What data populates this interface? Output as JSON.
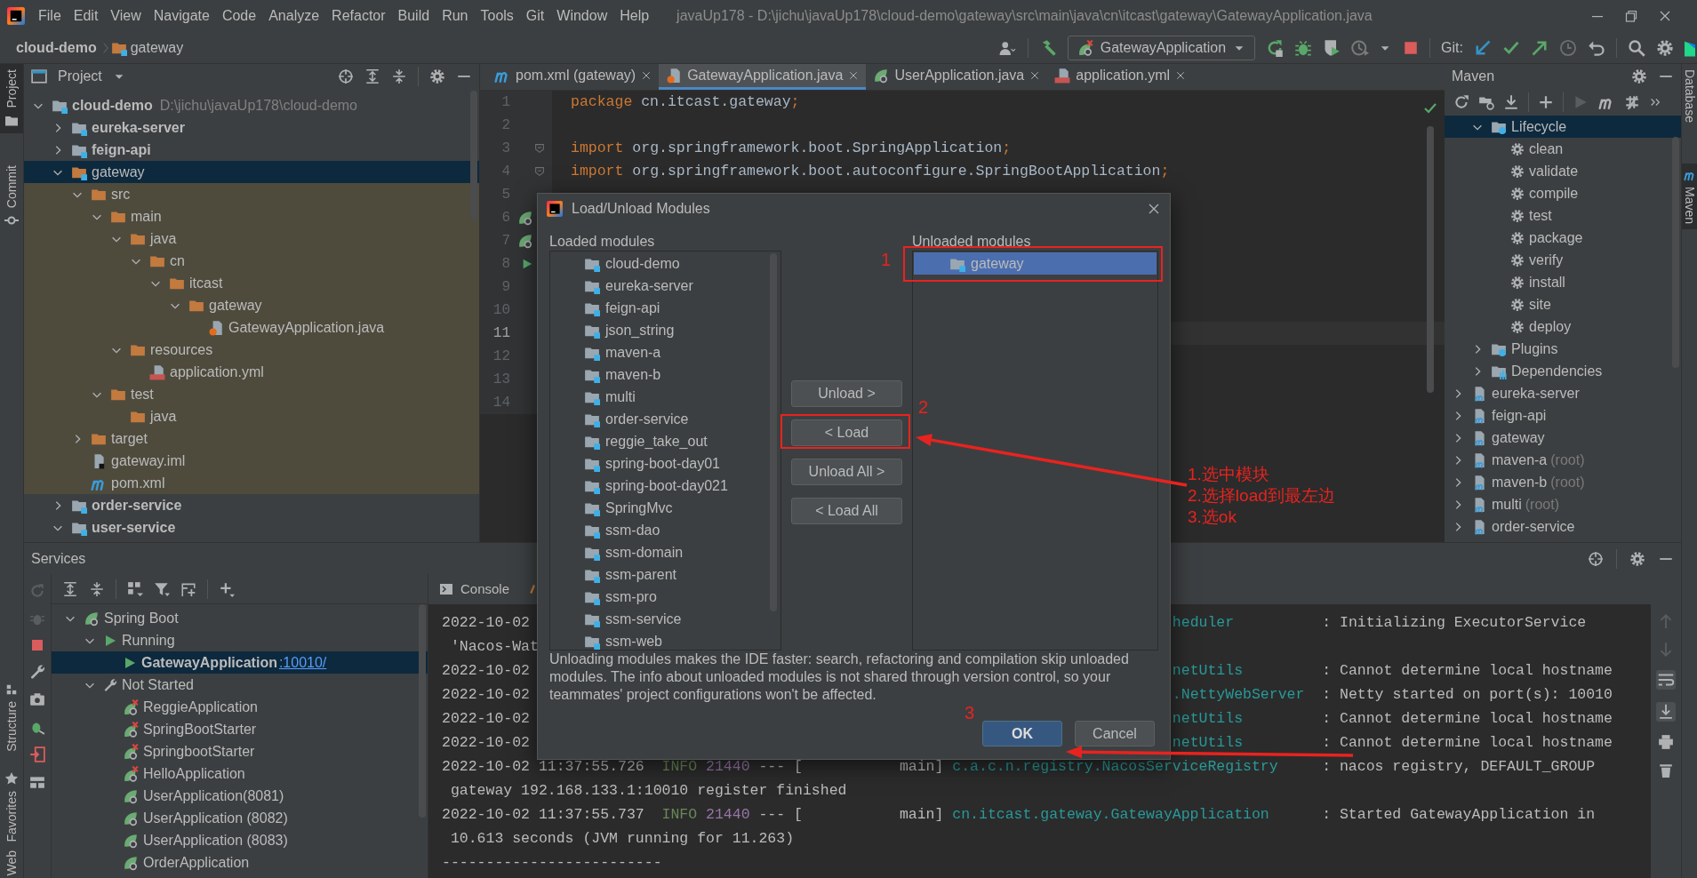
{
  "window": {
    "title": "javaUp178 - D:\\jichu\\javaUp178\\cloud-demo\\gateway\\src\\main\\java\\cn\\itcast\\gateway\\GatewayApplication.java",
    "menu": [
      "File",
      "Edit",
      "View",
      "Navigate",
      "Code",
      "Analyze",
      "Refactor",
      "Build",
      "Run",
      "Tools",
      "Git",
      "Window",
      "Help"
    ]
  },
  "breadcrumb": [
    {
      "label": "cloud-demo",
      "kind": "project"
    },
    {
      "label": "gateway",
      "kind": "module"
    }
  ],
  "toolbar": {
    "run_config": "GatewayApplication",
    "git_label": "Git:"
  },
  "left_stripe": [
    {
      "label": "Project",
      "selected": true
    },
    {
      "label": "Commit",
      "selected": false
    },
    {
      "label": "Structure",
      "selected": false
    },
    {
      "label": "Favorites",
      "selected": false
    },
    {
      "label": "Web",
      "selected": false
    }
  ],
  "right_stripe": [
    {
      "label": "Database",
      "selected": false
    },
    {
      "label": "Maven",
      "selected": true
    }
  ],
  "project_panel": {
    "title": "Project",
    "tree": [
      {
        "label": "cloud-demo",
        "hint": "D:\\jichu\\javaUp178\\cloud-demo",
        "kind": "module",
        "expanded": true,
        "selected": false,
        "children": [
          {
            "label": "eureka-server",
            "kind": "module",
            "expanded": false,
            "selected": false
          },
          {
            "label": "feign-api",
            "kind": "module",
            "expanded": false,
            "selected": false
          },
          {
            "label": "gateway",
            "kind": "module",
            "expanded": true,
            "selected": true,
            "unloaded": true,
            "children": [
              {
                "label": "src",
                "kind": "folder",
                "expanded": true,
                "selected": false,
                "children": [
                  {
                    "label": "main",
                    "kind": "folder",
                    "expanded": true,
                    "selected": false,
                    "children": [
                      {
                        "label": "java",
                        "kind": "folder",
                        "expanded": true,
                        "selected": false,
                        "children": [
                          {
                            "label": "cn",
                            "kind": "folder",
                            "expanded": true,
                            "selected": false,
                            "children": [
                              {
                                "label": "itcast",
                                "kind": "folder",
                                "expanded": true,
                                "selected": false,
                                "children": [
                                  {
                                    "label": "gateway",
                                    "kind": "folder",
                                    "expanded": true,
                                    "selected": false,
                                    "children": [
                                      {
                                        "label": "GatewayApplication.java",
                                        "kind": "java",
                                        "selected": false
                                      }
                                    ]
                                  }
                                ]
                              }
                            ]
                          }
                        ]
                      },
                      {
                        "label": "resources",
                        "kind": "folder",
                        "expanded": true,
                        "selected": false,
                        "children": [
                          {
                            "label": "application.yml",
                            "kind": "yml",
                            "selected": false
                          }
                        ]
                      }
                    ]
                  },
                  {
                    "label": "test",
                    "kind": "folder",
                    "expanded": true,
                    "selected": false,
                    "children": [
                      {
                        "label": "java",
                        "kind": "folder",
                        "selected": false
                      }
                    ]
                  }
                ]
              },
              {
                "label": "target",
                "kind": "folder",
                "expanded": false,
                "selected": false
              },
              {
                "label": "gateway.iml",
                "kind": "iml",
                "selected": false
              },
              {
                "label": "pom.xml",
                "kind": "pom",
                "selected": false
              }
            ]
          },
          {
            "label": "order-service",
            "kind": "module",
            "expanded": false,
            "selected": false
          },
          {
            "label": "user-service",
            "kind": "module",
            "expanded": true,
            "selected": false
          }
        ]
      }
    ]
  },
  "editor": {
    "tabs": [
      {
        "label": "pom.xml (gateway)",
        "kind": "pom",
        "selected": false
      },
      {
        "label": "GatewayApplication.java",
        "kind": "java",
        "selected": true
      },
      {
        "label": "UserApplication.java",
        "kind": "spring",
        "selected": false
      },
      {
        "label": "application.yml",
        "kind": "yml",
        "selected": false
      }
    ],
    "lines": [
      {
        "number": "1",
        "current": false,
        "code": [
          {
            "text": "package",
            "kind": "keyword"
          },
          {
            "text": " cn.itcast.gateway",
            "kind": "plain"
          },
          {
            "text": ";",
            "kind": "keyword"
          }
        ]
      },
      {
        "number": "2",
        "current": false
      },
      {
        "number": "3",
        "current": false,
        "gutter": {
          "kind": "fold"
        },
        "code": [
          {
            "text": "import",
            "kind": "keyword"
          },
          {
            "text": " org.springframework.boot.SpringApplication",
            "kind": "plain"
          },
          {
            "text": ";",
            "kind": "keyword"
          }
        ]
      },
      {
        "number": "4",
        "current": false,
        "gutter": {
          "kind": "fold"
        },
        "code": [
          {
            "text": "import",
            "kind": "keyword"
          },
          {
            "text": " org.springframework.boot.autoconfigure.SpringBootApplication",
            "kind": "plain"
          },
          {
            "text": ";",
            "kind": "keyword"
          }
        ]
      },
      {
        "number": "5",
        "current": false
      },
      {
        "number": "6",
        "current": false,
        "gutter": {
          "kind": "beans"
        }
      },
      {
        "number": "7",
        "current": false,
        "gutter": {
          "kind": "bean"
        }
      },
      {
        "number": "8",
        "current": false,
        "gutter": {
          "kind": "run"
        }
      },
      {
        "number": "9",
        "current": false
      },
      {
        "number": "10",
        "current": false
      },
      {
        "number": "11",
        "current": true
      },
      {
        "number": "12",
        "current": false
      },
      {
        "number": "13",
        "current": false
      },
      {
        "number": "14",
        "current": false
      }
    ]
  },
  "maven": {
    "title": "Maven",
    "continued_children": [
      {
        "label": "Lifecycle",
        "kind": "lifecycle",
        "expanded": true,
        "selected": true,
        "children": [
          {
            "label": "clean",
            "kind": "phase",
            "selected": false
          },
          {
            "label": "validate",
            "kind": "phase",
            "selected": false
          },
          {
            "label": "compile",
            "kind": "phase",
            "selected": false
          },
          {
            "label": "test",
            "kind": "phase",
            "selected": false
          },
          {
            "label": "package",
            "kind": "phase",
            "selected": false
          },
          {
            "label": "verify",
            "kind": "phase",
            "selected": false
          },
          {
            "label": "install",
            "kind": "phase",
            "selected": false
          },
          {
            "label": "site",
            "kind": "phase",
            "selected": false
          },
          {
            "label": "deploy",
            "kind": "phase",
            "selected": false
          }
        ]
      },
      {
        "label": "Plugins",
        "kind": "plugins",
        "expanded": false,
        "selected": false
      },
      {
        "label": "Dependencies",
        "kind": "dependencies",
        "expanded": false,
        "selected": false
      }
    ],
    "tree": [
      {
        "label": "eureka-server",
        "kind": "mvnmodule",
        "expanded": false,
        "selected": false
      },
      {
        "label": "feign-api",
        "kind": "mvnmodule",
        "expanded": false,
        "selected": false
      },
      {
        "label": "gateway",
        "kind": "mvnmodule",
        "expanded": false,
        "selected": false
      },
      {
        "label": "maven-a",
        "suffix": "(root)",
        "kind": "mvnmodule",
        "expanded": false,
        "selected": false
      },
      {
        "label": "maven-b",
        "suffix": "(root)",
        "kind": "mvnmodule",
        "expanded": false,
        "selected": false
      },
      {
        "label": "multi",
        "suffix": "(root)",
        "kind": "mvnmodule",
        "expanded": false,
        "selected": false
      },
      {
        "label": "order-service",
        "kind": "mvnmodule",
        "expanded": false,
        "selected": false
      }
    ]
  },
  "services": {
    "title": "Services",
    "tree": [
      {
        "label": "Spring Boot",
        "kind": "spring",
        "expanded": true,
        "selected": false,
        "children": [
          {
            "label": "Running",
            "kind": "running",
            "expanded": true,
            "selected": false,
            "children": [
              {
                "label": "GatewayApplication",
                "port": ":10010/",
                "kind": "app_running",
                "selected": true
              }
            ]
          },
          {
            "label": "Not Started",
            "kind": "not_started",
            "expanded": true,
            "selected": false,
            "children": [
              {
                "label": "ReggieApplication",
                "kind": "app",
                "error": true,
                "selected": false
              },
              {
                "label": "SpringBootStarter",
                "kind": "app",
                "error": true,
                "selected": false
              },
              {
                "label": "SpringbootStarter",
                "kind": "app",
                "error": true,
                "selected": false
              },
              {
                "label": "HelloApplication",
                "kind": "app",
                "error": true,
                "selected": false
              },
              {
                "label": "UserApplication(8081)",
                "kind": "app",
                "error": false,
                "selected": false
              },
              {
                "label": "UserApplication (8082)",
                "kind": "app",
                "error": false,
                "selected": false
              },
              {
                "label": "UserApplication (8083)",
                "kind": "app",
                "error": false,
                "selected": false
              },
              {
                "label": "OrderApplication",
                "kind": "app",
                "error": false,
                "selected": false
              }
            ]
          }
        ]
      }
    ],
    "console_tab": "Console",
    "console_lines": [
      {
        "left": [
          {
            "text": "2022-10-02",
            "kind": "timestamp"
          }
        ],
        "right": [
          {
            "text": "heduler",
            "kind": "logger"
          },
          {
            "text": ": Initializing ExecutorService",
            "kind": "message"
          }
        ]
      },
      {
        "left": [
          {
            "text": "'Nacos-Wat",
            "kind": "cont"
          }
        ]
      },
      {
        "left": [
          {
            "text": "2022-10-02",
            "kind": "timestamp"
          }
        ],
        "right": [
          {
            "text": "netUtils",
            "kind": "logger"
          },
          {
            "text": ": Cannot determine local hostname",
            "kind": "message"
          }
        ]
      },
      {
        "left": [
          {
            "text": "2022-10-02",
            "kind": "timestamp"
          }
        ],
        "right": [
          {
            "text": ".NettyWebServer",
            "kind": "logger"
          },
          {
            "text": ": Netty started on port(s): 10010",
            "kind": "message"
          }
        ]
      },
      {
        "left": [
          {
            "text": "2022-10-02",
            "kind": "timestamp"
          }
        ],
        "right": [
          {
            "text": "netUtils",
            "kind": "logger"
          },
          {
            "text": ": Cannot determine local hostname",
            "kind": "message"
          }
        ]
      },
      {
        "left": [
          {
            "text": "2022-10-02",
            "kind": "timestamp"
          }
        ],
        "right": [
          {
            "text": "netUtils",
            "kind": "logger"
          },
          {
            "text": ": Cannot determine local hostname",
            "kind": "message"
          }
        ]
      },
      {
        "left": [
          {
            "text": "2022-10-02 11:37:55.726",
            "kind": "timestamp"
          },
          {
            "text": "INFO",
            "kind": "level"
          },
          {
            "text": "21440",
            "kind": "pid"
          },
          {
            "text": "--- [           main]",
            "kind": "thread"
          },
          {
            "text": "c.a.c.n.registry.NacosServiceRegistry",
            "kind": "logger"
          },
          {
            "text": ": nacos registry, DEFAULT_GROUP",
            "kind": "message"
          }
        ]
      },
      {
        "left": [
          {
            "text": "gateway 192.168.133.1:10010 register finished",
            "kind": "cont"
          }
        ]
      },
      {
        "left": [
          {
            "text": "2022-10-02 11:37:55.737",
            "kind": "timestamp"
          },
          {
            "text": "INFO",
            "kind": "level"
          },
          {
            "text": "21440",
            "kind": "pid"
          },
          {
            "text": "--- [           main]",
            "kind": "thread"
          },
          {
            "text": "cn.itcast.gateway.GatewayApplication",
            "kind": "logger"
          },
          {
            "text": ": Started GatewayApplication in",
            "kind": "message"
          }
        ]
      },
      {
        "left": [
          {
            "text": "10.613 seconds (JVM running for 11.263)",
            "kind": "cont"
          }
        ]
      },
      {
        "left": [
          {
            "text": "-------------------------",
            "kind": "timestamp"
          }
        ]
      }
    ]
  },
  "dialog": {
    "title": "Load/Unload Modules",
    "loaded_label": "Loaded modules",
    "unloaded_label": "Unloaded modules",
    "loaded": [
      {
        "label": "cloud-demo",
        "selected": false
      },
      {
        "label": "eureka-server",
        "selected": false
      },
      {
        "label": "feign-api",
        "selected": false
      },
      {
        "label": "json_string",
        "selected": false
      },
      {
        "label": "maven-a",
        "selected": false
      },
      {
        "label": "maven-b",
        "selected": false
      },
      {
        "label": "multi",
        "selected": false
      },
      {
        "label": "order-service",
        "selected": false
      },
      {
        "label": "reggie_take_out",
        "selected": false
      },
      {
        "label": "spring-boot-day01",
        "selected": false
      },
      {
        "label": "spring-boot-day021",
        "selected": false
      },
      {
        "label": "SpringMvc",
        "selected": false
      },
      {
        "label": "ssm-dao",
        "selected": false
      },
      {
        "label": "ssm-domain",
        "selected": false
      },
      {
        "label": "ssm-parent",
        "selected": false
      },
      {
        "label": "ssm-pro",
        "selected": false
      },
      {
        "label": "ssm-service",
        "selected": false
      },
      {
        "label": "ssm-web",
        "selected": false
      }
    ],
    "unloaded": [
      {
        "label": "gateway",
        "selected": true
      }
    ],
    "move_buttons": [
      "Unload >",
      "< Load",
      "Unload All >",
      "< Load All"
    ],
    "description": "Unloading modules makes the IDE faster: search, refactoring and compilation skip unloaded modules. The info about unloaded modules is not shared through version control, so your teammates' project configurations won't be affected.",
    "footer_buttons": [
      {
        "label": "OK",
        "kind": "primary"
      },
      {
        "label": "Cancel",
        "kind": "secondary"
      }
    ]
  },
  "annotations": {
    "markers": [
      "1",
      "2",
      "3"
    ],
    "note": [
      "1.选中模块",
      "2.选择load到最左边",
      "3.选ok"
    ]
  }
}
